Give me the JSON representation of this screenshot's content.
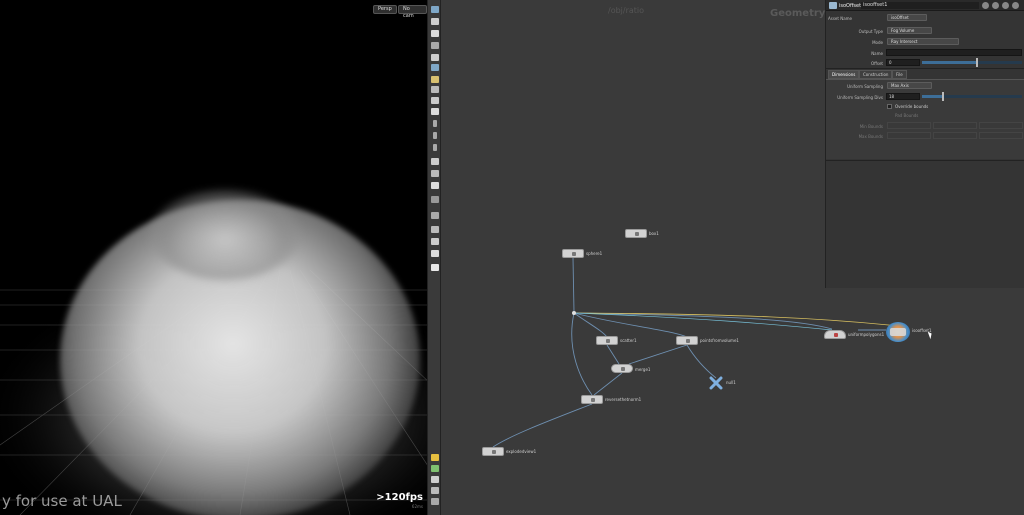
{
  "viewport": {
    "persp_button": "Persp",
    "camera_button": "No cam",
    "fps": ">120fps",
    "fps_sub": "62ms",
    "watermark": "y for use at UAL"
  },
  "network": {
    "context_label": "/obj/ratio",
    "geometry_label": "Geometry",
    "nodes": [
      {
        "key": "box1",
        "label": "box1"
      },
      {
        "key": "sphere1",
        "label": "sphere1"
      },
      {
        "key": "scatter1",
        "label": "scatter1"
      },
      {
        "key": "pointsfromvolume1",
        "label": "pointsfromvolume1"
      },
      {
        "key": "merge1",
        "label": "merge1"
      },
      {
        "key": "null1",
        "label": "null1"
      },
      {
        "key": "reversethetnorm1",
        "label": "reversethetnorm1"
      },
      {
        "key": "explodedview1",
        "label": "explodedview1"
      },
      {
        "key": "uniformpolygons1",
        "label": "uniformpolygons1"
      },
      {
        "key": "isooffset1",
        "label": "isooffset1"
      }
    ]
  },
  "params": {
    "node_type": "isoOffset",
    "node_name": "isooffset1",
    "asset_name_label": "Asset Name",
    "asset_name_value": "isoOffset",
    "output_type_label": "Output Type",
    "output_type_value": "Fog Volume",
    "mode_label": "Mode",
    "mode_value": "Ray Intersect",
    "name_label": "Name",
    "name_value": "",
    "offset_label": "Offset",
    "offset_value": "0",
    "tabs": [
      "Dimensions",
      "Construction",
      "File"
    ],
    "uniform_sampling_label": "Uniform Sampling",
    "uniform_sampling_value": "Max Axis",
    "uniform_divs_label": "Uniform Sampling Divs",
    "uniform_divs_value": "18",
    "override_bounds_label": "Override bounds",
    "pad_bounds_label": "Pad Bounds",
    "min_bounds_label": "Min Bounds",
    "max_bounds_label": "Max Bounds"
  },
  "colors": {
    "viewport_bg": "#000000",
    "network_bg": "#3a3a3a",
    "wire": "#6e8fb0",
    "slider_fill": "#3d6e98"
  }
}
